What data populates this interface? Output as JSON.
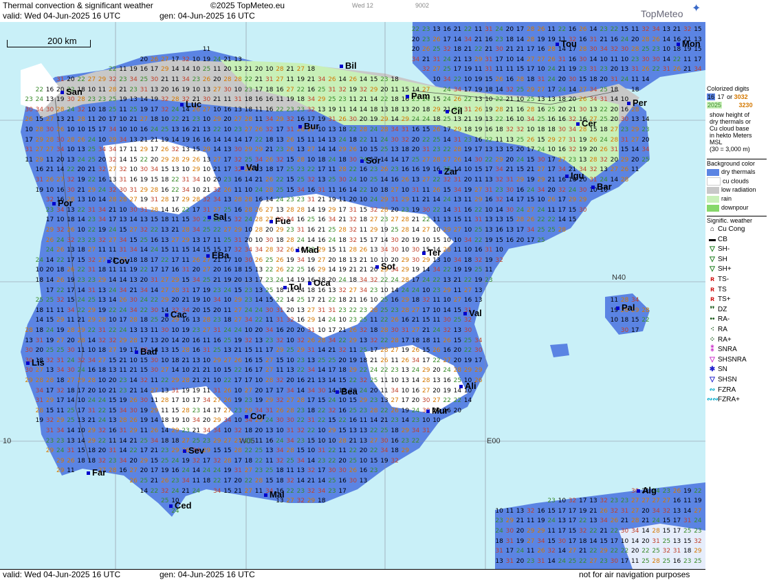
{
  "header": {
    "title": "Thermal convection & significant weather",
    "copyright": "©2025 TopMeteo.eu",
    "code1": "Wed 12",
    "code2": "9002",
    "valid": "valid:  Wed  04-Jun-2025  16 UTC",
    "gen": "gen: 04-Jun-2025 16 UTC",
    "brand": "TopMeteo"
  },
  "map": {
    "scale_label": "200 km",
    "grid_labels": {
      "n40": "N40",
      "w05": "W05",
      "e00": "E00",
      "w10": "10"
    },
    "cities": [
      {
        "name": "Bil"
      },
      {
        "name": "San"
      },
      {
        "name": "Luc"
      },
      {
        "name": "Pam"
      },
      {
        "name": "Tou"
      },
      {
        "name": "Mon"
      },
      {
        "name": "Per"
      },
      {
        "name": "Cil"
      },
      {
        "name": "Bur"
      },
      {
        "name": "Cer"
      },
      {
        "name": "Sor"
      },
      {
        "name": "Val"
      },
      {
        "name": "Zar"
      },
      {
        "name": "Igu"
      },
      {
        "name": "Bar"
      },
      {
        "name": "Por"
      },
      {
        "name": "Sal"
      },
      {
        "name": "Fue"
      },
      {
        "name": "Mad"
      },
      {
        "name": "Cov"
      },
      {
        "name": "EBa"
      },
      {
        "name": "Sot"
      },
      {
        "name": "Ter"
      },
      {
        "name": "Tol"
      },
      {
        "name": "Oca"
      },
      {
        "name": "Pal"
      },
      {
        "name": "Cac"
      },
      {
        "name": "Val"
      },
      {
        "name": "Bad"
      },
      {
        "name": "Lis"
      },
      {
        "name": "Bea"
      },
      {
        "name": "Ali"
      },
      {
        "name": "Cor"
      },
      {
        "name": "Mur"
      },
      {
        "name": "Sev"
      },
      {
        "name": "Far"
      },
      {
        "name": "Mal"
      },
      {
        "name": "Ced"
      },
      {
        "name": "Alg"
      }
    ],
    "sample_values": [
      "10",
      "11",
      "13",
      "14",
      "15",
      "16",
      "17",
      "18",
      "19",
      "20",
      "21",
      "22",
      "23",
      "24",
      "25",
      "26",
      "27",
      "28",
      "29",
      "30",
      "31",
      "32",
      "34"
    ]
  },
  "footer": {
    "valid": "valid:  Wed  04-Jun-2025  16 UTC",
    "gen": "gen: 04-Jun-2025 16 UTC",
    "disclaimer": "not for air navigation purposes"
  },
  "legend": {
    "colorized_title": "Colorized digits",
    "sample_a1": "16",
    "sample_a2": "17",
    "or": "or",
    "sample_b1": "3032",
    "sample_b2": "3230",
    "sample_c1": "2025",
    "desc": [
      "show height of",
      "dry thermals or",
      "Cu cloud base",
      "in hekto Meters",
      "MSL",
      "(30 = 3,000 m)"
    ],
    "bg_title": "Background color",
    "bg_items": [
      {
        "label": "dry thermals",
        "color": "#5b84e3"
      },
      {
        "label": "cu clouds",
        "color": "#ffffff"
      },
      {
        "label": "low radiation",
        "color": "#c8c8c8"
      },
      {
        "label": "rain",
        "color": "#c8f0b8"
      },
      {
        "label": "downpour",
        "color": "#86d86a"
      }
    ],
    "wx_title": "Signific. weather",
    "wx_items": [
      {
        "label": "Cu Cong",
        "sym": "⌂",
        "color": "#000000"
      },
      {
        "label": "CB",
        "sym": "▬",
        "color": "#000000"
      },
      {
        "label": "SH-",
        "sym": "▽",
        "color": "#1a7a1a"
      },
      {
        "label": "SH",
        "sym": "▽",
        "color": "#1a7a1a"
      },
      {
        "label": "SH+",
        "sym": "▽",
        "color": "#1a7a1a"
      },
      {
        "label": "TS-",
        "sym": "ʀ",
        "color": "#cc0000"
      },
      {
        "label": "TS",
        "sym": "ʀ",
        "color": "#cc0000"
      },
      {
        "label": "TS+",
        "sym": "ʀ",
        "color": "#cc0000"
      },
      {
        "label": "DZ",
        "sym": "❜❜",
        "color": "#1a5a1a"
      },
      {
        "label": "RA-",
        "sym": "••",
        "color": "#1a5a1a"
      },
      {
        "label": "RA",
        "sym": "⁖",
        "color": "#1a5a1a"
      },
      {
        "label": "RA+",
        "sym": "⁘",
        "color": "#1a5a1a"
      },
      {
        "label": "SNRA",
        "sym": "⁑",
        "color": "#cc33cc"
      },
      {
        "label": "SHSNRA",
        "sym": "▽",
        "color": "#cc33cc"
      },
      {
        "label": "SN",
        "sym": "✱",
        "color": "#2222cc"
      },
      {
        "label": "SHSN",
        "sym": "▽",
        "color": "#2222cc"
      },
      {
        "label": "FZRA",
        "sym": "∾",
        "color": "#00aacc"
      },
      {
        "label": "FZRA+",
        "sym": "∾∾",
        "color": "#00aacc"
      }
    ]
  }
}
